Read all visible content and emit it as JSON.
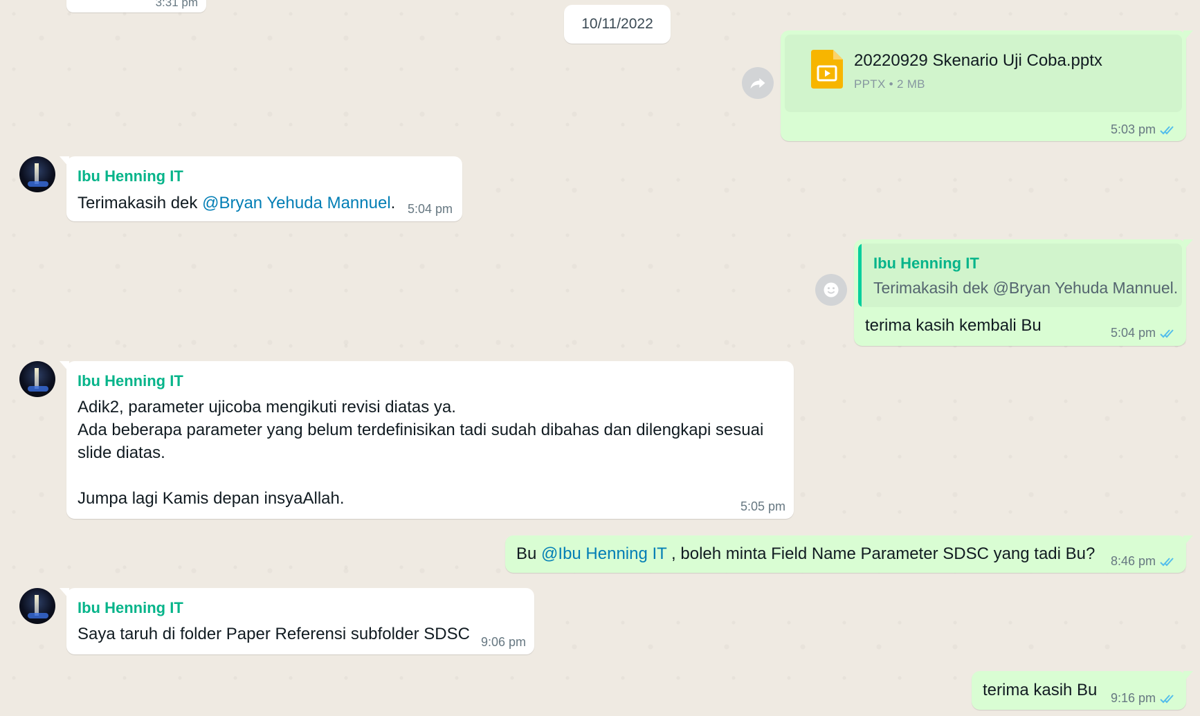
{
  "partial_top": {
    "time": "3:31 pm"
  },
  "date_divider": "10/11/2022",
  "messages": [
    {
      "file_name": "20220929 Skenario Uji Coba.pptx",
      "file_type": "PPTX",
      "file_separator": "•",
      "file_size": "2 MB",
      "time": "5:03 pm"
    },
    {
      "sender": "Ibu Henning IT",
      "text_before": "Terimakasih dek ",
      "mention": "@Bryan Yehuda Mannuel",
      "text_after": ".",
      "time": "5:04 pm"
    },
    {
      "quote_sender": "Ibu Henning IT",
      "quote_text": "Terimakasih dek @Bryan Yehuda Mannuel.",
      "text": "terima kasih kembali Bu",
      "time": "5:04 pm"
    },
    {
      "sender": "Ibu Henning IT",
      "lines": [
        "Adik2, parameter ujicoba mengikuti revisi diatas ya.",
        "Ada beberapa parameter yang belum terdefinisikan tadi sudah dibahas dan dilengkapi sesuai",
        "slide diatas.",
        "",
        "Jumpa lagi Kamis depan insyaAllah."
      ],
      "time": "5:05 pm"
    },
    {
      "text_before": "Bu ",
      "mention": "@Ibu Henning IT",
      "text_after": " , boleh minta Field Name Parameter SDSC yang tadi Bu?",
      "time": "8:46 pm"
    },
    {
      "sender": "Ibu Henning IT",
      "text": "Saya taruh di folder Paper Referensi subfolder SDSC",
      "time": "9:06 pm"
    },
    {
      "text": "terima kasih Bu",
      "time": "9:16 pm"
    }
  ],
  "colors": {
    "chat_background": "#efeae2",
    "incoming_bubble": "#ffffff",
    "outgoing_bubble": "#d9fdd3",
    "sender_name": "#06b48a",
    "mention": "#027eb5",
    "read_ticks": "#53bdeb",
    "file_icon": "#f7b500"
  },
  "icons": {
    "forward": "forward-icon",
    "react": "emoji-icon",
    "file": "slides-file-icon",
    "read": "double-check-icon"
  }
}
